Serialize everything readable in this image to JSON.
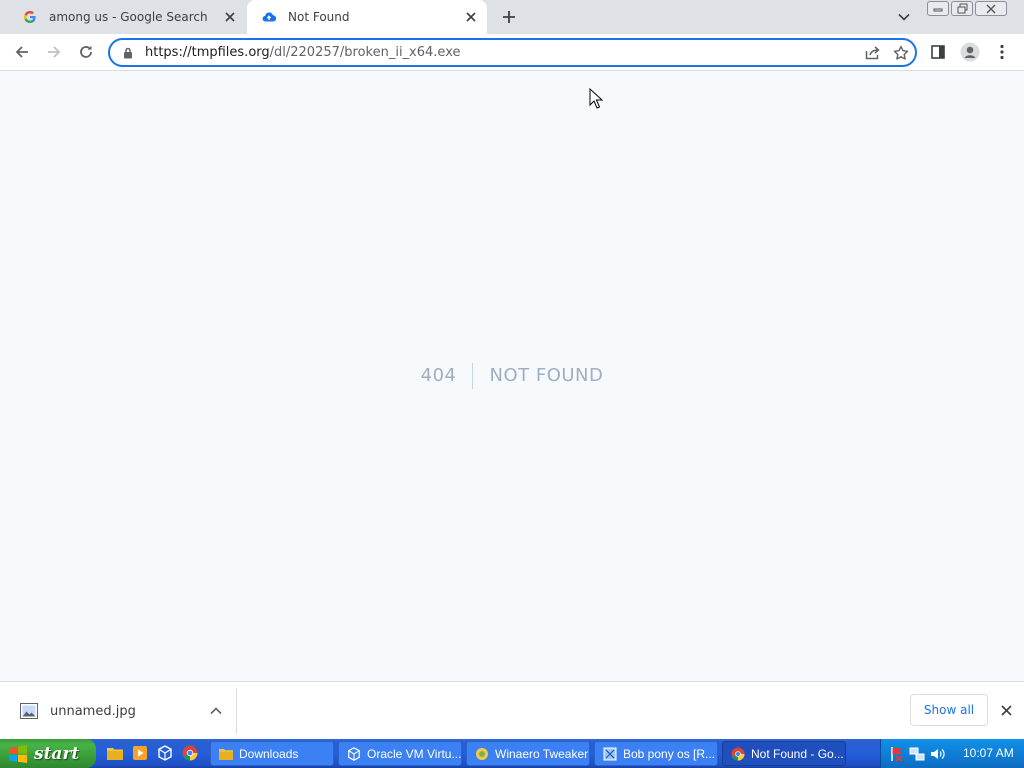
{
  "tabs": [
    {
      "title": "among us - Google Search",
      "icon": "google-icon",
      "active": false
    },
    {
      "title": "Not Found",
      "icon": "cloud-upload-icon",
      "active": true
    }
  ],
  "omnibox": {
    "url_host": "https://tmpfiles.org",
    "url_path": "/dl/220257/broken_ii_x64.exe"
  },
  "page": {
    "code": "404",
    "message": "Not Found"
  },
  "downloads": {
    "file_name": "unnamed.jpg",
    "show_all_label": "Show all"
  },
  "taskbar": {
    "start_label": "start",
    "tasks": [
      {
        "label": "Downloads",
        "icon": "folder-icon"
      },
      {
        "label": "Oracle VM Virtu...",
        "icon": "virtualbox-icon"
      },
      {
        "label": "Winaero Tweaker",
        "icon": "winaero-icon"
      },
      {
        "label": "Bob pony os [R...",
        "icon": "app-icon"
      },
      {
        "label": "Not Found - Go...",
        "icon": "chrome-icon"
      }
    ],
    "clock": "10:07 AM"
  },
  "colors": {
    "accent": "#1a73e8",
    "page_bg": "#f7fafc",
    "notfound_text": "#a0aec0",
    "taskbar_blue": "#245edb",
    "start_green": "#3a9d3a"
  }
}
